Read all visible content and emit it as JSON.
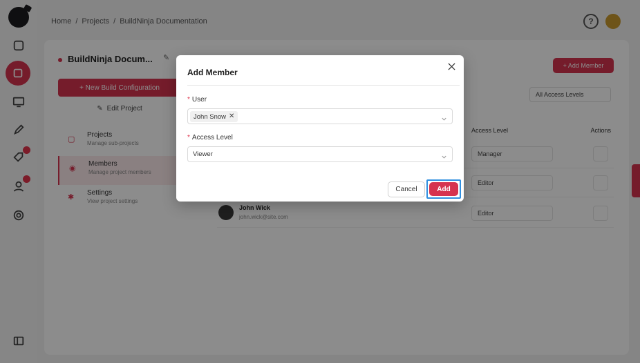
{
  "background": {
    "breadcrumb": [
      "Home",
      "Projects",
      "BuildNinja Documentation"
    ],
    "project_title": "BuildNinja Docum...",
    "new_build_label": "+ New Build Configuration",
    "edit_project_label": "Edit Project",
    "side_nav": [
      {
        "title": "Projects",
        "subtitle": "Manage sub-projects"
      },
      {
        "title": "Members",
        "subtitle": "Manage project members"
      },
      {
        "title": "Settings",
        "subtitle": "View project settings"
      }
    ],
    "add_member_label": "+ Add Member",
    "filter_label": "All Access Levels",
    "table_headers": {
      "access": "Access Level",
      "actions": "Actions"
    },
    "rows": [
      {
        "name": "",
        "email": "",
        "access": "Manager"
      },
      {
        "name": "",
        "email": "",
        "access": "Editor"
      },
      {
        "name": "John Wick",
        "email": "john.wick@site.com",
        "access": "Editor"
      }
    ]
  },
  "modal": {
    "title": "Add Member",
    "user": {
      "label": "User",
      "tags": [
        "John Snow"
      ]
    },
    "access_level": {
      "label": "Access Level",
      "value": "Viewer"
    },
    "cancel_label": "Cancel",
    "add_label": "Add"
  },
  "colors": {
    "accent": "#d6334f",
    "focus_ring": "#2f8fe0"
  }
}
